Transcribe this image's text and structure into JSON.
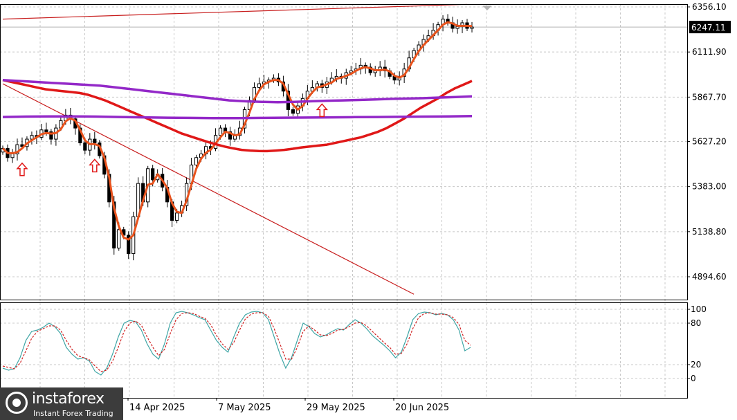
{
  "chart_data": [
    {
      "type": "candlestick",
      "title": "",
      "price_axis": {
        "ticks": [
          6356.1,
          6111.9,
          5867.7,
          5627.2,
          5383.0,
          5138.8,
          4894.6
        ],
        "tick_labels": [
          "6356.10",
          "6111.90",
          "5867.70",
          "5627.20",
          "5383.00",
          "5138.80",
          "4894.60"
        ],
        "current_price": 6247.11,
        "current_price_label": "6247.11",
        "range": [
          4770,
          6375
        ]
      },
      "date_axis": {
        "labels": [
          "14 Apr 2025",
          "7 May 2025",
          "29 May 2025",
          "20 Jun 2025"
        ]
      },
      "candles_close": [
        5590,
        5540,
        5560,
        5610,
        5600,
        5640,
        5660,
        5650,
        5690,
        5680,
        5640,
        5700,
        5740,
        5770,
        5750,
        5700,
        5620,
        5580,
        5640,
        5620,
        5550,
        5450,
        5300,
        5050,
        5150,
        5120,
        5020,
        5220,
        5400,
        5300,
        5480,
        5420,
        5450,
        5380,
        5300,
        5200,
        5240,
        5280,
        5400,
        5500,
        5540,
        5560,
        5600,
        5590,
        5660,
        5700,
        5680,
        5640,
        5660,
        5700,
        5800,
        5850,
        5920,
        5940,
        5950,
        5960,
        5970,
        5950,
        5900,
        5800,
        5780,
        5820,
        5860,
        5900,
        5920,
        5940,
        5920,
        5950,
        5970,
        5980,
        5970,
        6000,
        6010,
        6020,
        6040,
        6030,
        6000,
        6010,
        6030,
        6010,
        5980,
        5960,
        5980,
        6020,
        6080,
        6120,
        6150,
        6180,
        6200,
        6230,
        6260,
        6290,
        6270,
        6240,
        6250,
        6270,
        6240,
        6247
      ],
      "series": [
        {
          "name": "",
          "color": "#e8521c",
          "kind": "fast-ma"
        },
        {
          "name": "",
          "color": "#e01818",
          "kind": "slow-ma",
          "values": [
            5960,
            5950,
            5940,
            5930,
            5920,
            5910,
            5905,
            5900,
            5895,
            5890,
            5880,
            5865,
            5850,
            5830,
            5810,
            5790,
            5770,
            5750,
            5730,
            5710,
            5690,
            5670,
            5655,
            5640,
            5625,
            5612,
            5600,
            5590,
            5582,
            5578,
            5576,
            5575,
            5578,
            5582,
            5588,
            5595,
            5600,
            5605,
            5610,
            5620,
            5630,
            5640,
            5650,
            5665,
            5680,
            5700,
            5725,
            5750,
            5780,
            5810,
            5835,
            5860,
            5890,
            5915,
            5935,
            5955
          ]
        },
        {
          "name": "",
          "color": "#9328c8",
          "kind": "ma-upper",
          "values": [
            5960,
            5955,
            5950,
            5945,
            5940,
            5935,
            5930,
            5920,
            5910,
            5900,
            5890,
            5880,
            5870,
            5860,
            5850,
            5845,
            5842,
            5840,
            5842,
            5845,
            5848,
            5850,
            5852,
            5855,
            5858,
            5860,
            5862,
            5865,
            5868,
            5872
          ]
        },
        {
          "name": "",
          "color": "#9328c8",
          "kind": "ma-lower",
          "values": [
            5760,
            5762,
            5763,
            5763,
            5762,
            5760,
            5758,
            5756,
            5755,
            5754,
            5754,
            5755,
            5756,
            5757,
            5758,
            5759,
            5760,
            5761,
            5762,
            5763,
            5765
          ]
        }
      ],
      "trendlines": [
        {
          "from": [
            0,
            6290
          ],
          "to": [
            96,
            6370
          ],
          "color": "#c81e1e"
        },
        {
          "from": [
            0,
            5940
          ],
          "to": [
            85,
            4800
          ],
          "color": "#c81e1e"
        }
      ],
      "arrows_up": [
        4,
        19,
        66
      ]
    },
    {
      "type": "line",
      "title": "",
      "ylim": [
        -5,
        110
      ],
      "y_ticks": [
        100,
        80,
        20,
        0
      ],
      "y_tick_labels": [
        "100",
        "80",
        "20",
        "0"
      ],
      "series": [
        {
          "name": "",
          "color": "#3fa6a6",
          "style": "solid",
          "values": [
            15,
            12,
            14,
            30,
            55,
            68,
            70,
            74,
            80,
            75,
            65,
            45,
            35,
            28,
            30,
            25,
            10,
            5,
            15,
            35,
            60,
            80,
            84,
            82,
            70,
            50,
            35,
            28,
            50,
            80,
            95,
            97,
            95,
            92,
            88,
            85,
            70,
            55,
            45,
            38,
            60,
            80,
            92,
            96,
            97,
            95,
            85,
            60,
            35,
            15,
            30,
            55,
            80,
            75,
            65,
            60,
            63,
            68,
            72,
            70,
            78,
            85,
            80,
            72,
            62,
            55,
            48,
            40,
            30,
            38,
            60,
            85,
            94,
            96,
            95,
            92,
            94,
            92,
            85,
            70,
            40,
            45
          ]
        },
        {
          "name": "",
          "color": "#d02020",
          "style": "dashed",
          "values": [
            18,
            16,
            14,
            22,
            40,
            58,
            68,
            72,
            76,
            76,
            70,
            55,
            42,
            33,
            30,
            27,
            18,
            10,
            12,
            25,
            45,
            68,
            80,
            83,
            77,
            60,
            45,
            33,
            42,
            65,
            85,
            94,
            95,
            94,
            90,
            87,
            78,
            62,
            50,
            42,
            52,
            70,
            86,
            93,
            95,
            95,
            90,
            72,
            50,
            28,
            28,
            45,
            68,
            76,
            70,
            63,
            62,
            65,
            70,
            71,
            75,
            80,
            81,
            76,
            68,
            60,
            52,
            45,
            35,
            36,
            50,
            72,
            88,
            94,
            95,
            93,
            93,
            92,
            88,
            78,
            55,
            48
          ]
        }
      ]
    }
  ],
  "watermark": {
    "name": "instaforex",
    "tagline": "Instant Forex Trading"
  }
}
